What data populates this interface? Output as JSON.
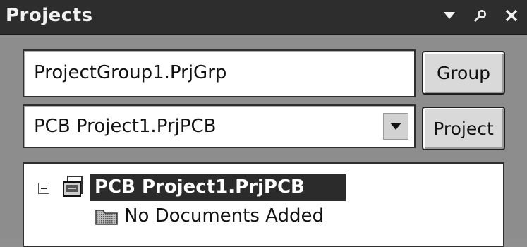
{
  "panel": {
    "title": "Projects",
    "title_icons": [
      "chevron-down-icon",
      "pin-icon",
      "close-icon"
    ]
  },
  "workspace": {
    "group_value": "ProjectGroup1.PrjGrp",
    "group_button": "Group",
    "project_value": "PCB Project1.PrjPCB",
    "project_button": "Project"
  },
  "tree": {
    "items": [
      {
        "label": "PCB Project1.PrjPCB",
        "selected": true,
        "icon": "pcb-project-icon",
        "expanded": true
      },
      {
        "label": "No Documents Added",
        "selected": false,
        "icon": "folder-icon"
      }
    ]
  },
  "colors": {
    "titlebar": "#2d2d2d",
    "panel_bg": "#8d8d8d",
    "selection": "#2b2b2b"
  }
}
